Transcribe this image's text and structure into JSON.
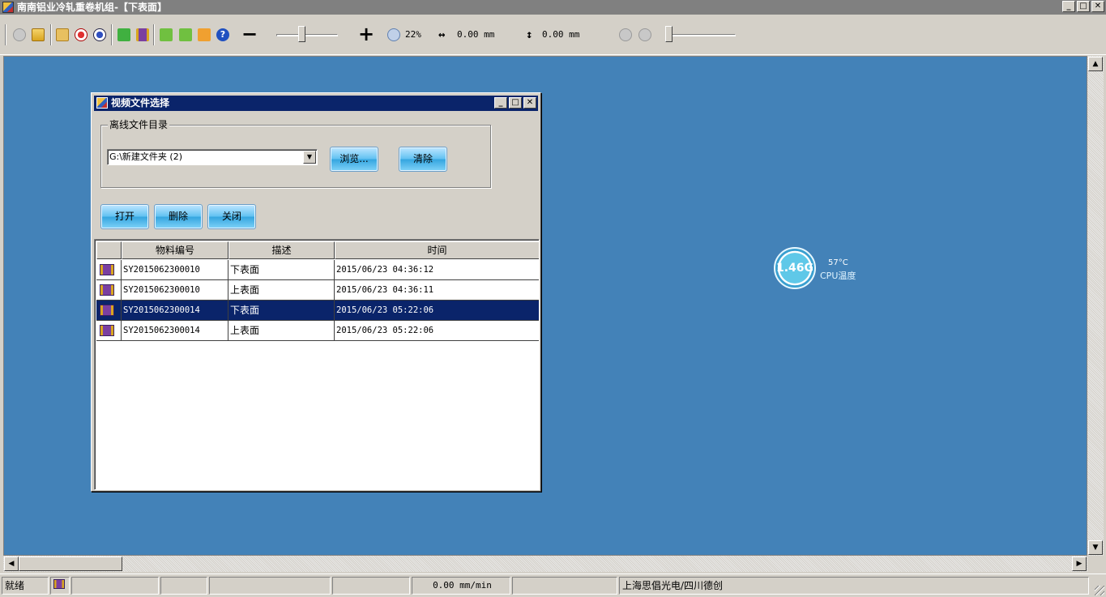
{
  "window": {
    "title": "南南铝业冷轧重卷机组-【下表面】"
  },
  "toolbar": {
    "zoom_percent": "22%",
    "width_value": "0.00 mm",
    "height_value": "0.00 mm"
  },
  "dialog": {
    "title": "视频文件选择",
    "group_label": "离线文件目录",
    "directory": "G:\\新建文件夹 (2)",
    "browse_label": "浏览...",
    "clear_label": "清除",
    "open_label": "打开",
    "delete_label": "删除",
    "close_label": "关闭",
    "columns": [
      "物料编号",
      "描述",
      "时间"
    ],
    "rows": [
      {
        "id": "SY2015062300010",
        "desc": "下表面",
        "time": "2015/06/23 04:36:12"
      },
      {
        "id": "SY2015062300010",
        "desc": "上表面",
        "time": "2015/06/23 04:36:11"
      },
      {
        "id": "SY2015062300014",
        "desc": "下表面",
        "time": "2015/06/23 05:22:06"
      },
      {
        "id": "SY2015062300014",
        "desc": "上表面",
        "time": "2015/06/23 05:22:06"
      }
    ]
  },
  "cpu": {
    "value": "1.46G",
    "temp": "57°C",
    "label": "CPU温度"
  },
  "status": {
    "ready": "就绪",
    "speed": "0.00 mm/min",
    "company": "上海思倡光电/四川德创"
  },
  "colors": {
    "desktop": "#4382b8",
    "selection": "#0a246a",
    "button": "#62c2f2"
  }
}
